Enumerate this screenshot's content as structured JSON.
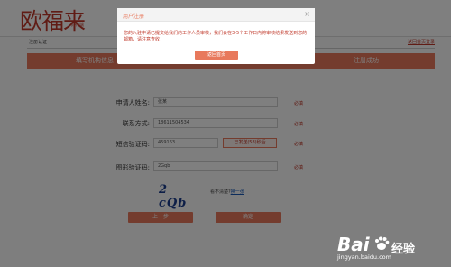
{
  "header": {
    "logo_text": "欧福来",
    "logo_sub": "机构端"
  },
  "subbar": {
    "left_text": "注册认证",
    "right_link": "返回首页登录"
  },
  "steps": [
    "填写机构信息",
    "",
    "注册成功"
  ],
  "form": {
    "name_label": "申请人姓名:",
    "name_value": "张某",
    "phone_label": "联系方式:",
    "phone_value": "18611504534",
    "sms_label": "短信验证码:",
    "sms_value": "459163",
    "sms_button": "已发送(58)秒后",
    "captcha_label": "图形验证码:",
    "captcha_value": "2Gqb",
    "captcha_image_text": "2 cQb",
    "captcha_hint_prefix": "看不清楚?",
    "captcha_hint_link": "换一张",
    "required_text": "必填",
    "prev_button": "上一步",
    "next_button": "确定"
  },
  "dialog": {
    "title": "用户注册",
    "close_glyph": "×",
    "message": "您的入驻申请已提交给我们的工作人员审核，我们会在3-5个工作日内将审核结果发送到您的邮箱，请注意查收！",
    "ok_button": "返回首页"
  },
  "watermark": {
    "brand": "Bai",
    "brand_suffix": "经验",
    "url": "jingyan.baidu.com"
  }
}
